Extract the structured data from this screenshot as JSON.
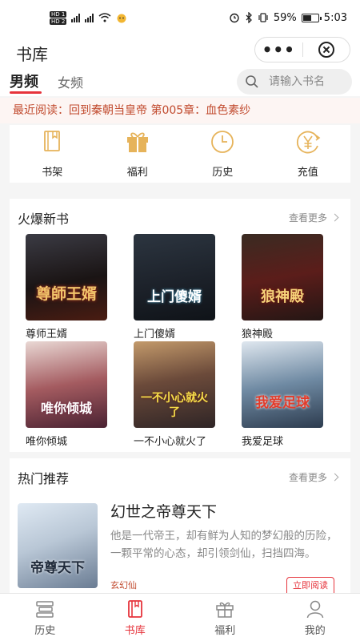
{
  "status_bar": {
    "time": "5:03",
    "battery": "59%",
    "battery_level": 0.59,
    "sim1": "HD 1",
    "sim2": "HD 2",
    "net": "4G"
  },
  "header": {
    "title": "书库",
    "more_icon": "more-dots-icon",
    "close_icon": "close-circle-icon"
  },
  "tabs": {
    "male": "男频",
    "female": "女频"
  },
  "search": {
    "placeholder": "请输入书名"
  },
  "recent_reading": "最近阅读：回到秦朝当皇帝 第005章：血色素纱",
  "quick_links": [
    {
      "label": "书架",
      "icon": "bookshelf-icon"
    },
    {
      "label": "福利",
      "icon": "gift-icon"
    },
    {
      "label": "历史",
      "icon": "clock-icon"
    },
    {
      "label": "充值",
      "icon": "yuan-coin-icon"
    }
  ],
  "hot_new": {
    "title": "火爆新书",
    "more": "查看更多",
    "books": [
      {
        "title": "尊师王婿",
        "cover_text": "尊師王婿"
      },
      {
        "title": "上门傻婿",
        "cover_text": "上门傻婿"
      },
      {
        "title": "狼神殿",
        "cover_text": "狼神殿"
      },
      {
        "title": "唯你倾城",
        "cover_text": "唯你倾城"
      },
      {
        "title": "一不小心就火了",
        "cover_text": "一不小心就火了"
      },
      {
        "title": "我爱足球",
        "cover_text": "我爱足球"
      }
    ]
  },
  "recommend": {
    "title": "热门推荐",
    "more": "查看更多",
    "book": {
      "title": "幻世之帝尊天下",
      "cover_text": "帝尊天下",
      "desc": "他是一代帝王，却有鲜为人知的梦幻般的历险，一颗平常的心态，却引领剑仙，扫挡四海。",
      "tag": "玄幻仙",
      "button": "立即阅读"
    }
  },
  "bottom_nav": [
    {
      "label": "历史",
      "icon": "history-icon"
    },
    {
      "label": "书库",
      "icon": "library-icon",
      "active": true
    },
    {
      "label": "福利",
      "icon": "gift-icon"
    },
    {
      "label": "我的",
      "icon": "user-icon"
    }
  ],
  "colors": {
    "accent": "#e6343c",
    "recent_text": "#c14a2e",
    "icon_gold": "#e6b35a"
  }
}
